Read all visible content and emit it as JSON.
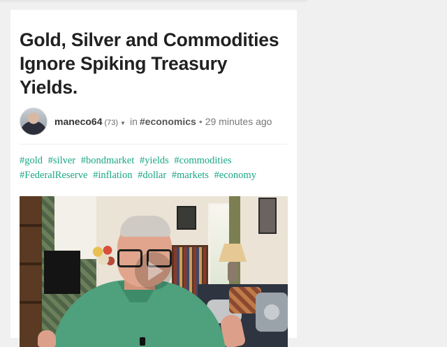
{
  "post": {
    "title": "Gold, Silver and Commodities Ignore Spiking Treasury Yields.",
    "author": {
      "name": "maneco64",
      "reputation": "(73)",
      "caret_icon": "caret-down-icon"
    },
    "community_prefix": "in",
    "community": "#economics",
    "separator": "•",
    "time_ago": "29 minutes ago",
    "tags": [
      "#gold",
      "#silver",
      "#bondmarket",
      "#yields",
      "#commodities",
      "#FederalReserve",
      "#inflation",
      "#dollar",
      "#markets",
      "#economy"
    ],
    "video": {
      "play_icon": "play-icon"
    }
  },
  "colors": {
    "tag": "#1aa684",
    "title": "#212121",
    "background": "#f0f0f0",
    "card": "#ffffff"
  }
}
